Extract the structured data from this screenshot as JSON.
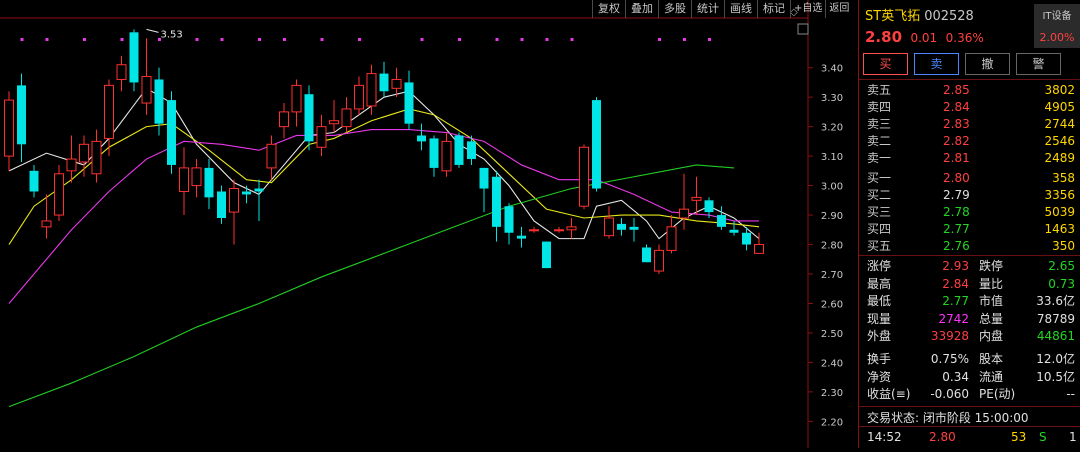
{
  "toolbar": {
    "items": [
      "复权",
      "叠加",
      "多股",
      "统计",
      "画线",
      "标记",
      "+自选",
      "返回"
    ]
  },
  "stock": {
    "name": "ST英飞拓",
    "code": "002528",
    "price": "2.80",
    "change": "0.01",
    "change_pct": "0.36%",
    "it_label": "IT设备",
    "it_pct": "2.00%"
  },
  "buttons": [
    "买",
    "卖",
    "撤",
    "警"
  ],
  "order_book": {
    "sell": [
      {
        "label": "卖五",
        "price": "2.85",
        "vol": "3802"
      },
      {
        "label": "卖四",
        "price": "2.84",
        "vol": "4905"
      },
      {
        "label": "卖三",
        "price": "2.83",
        "vol": "2744"
      },
      {
        "label": "卖二",
        "price": "2.82",
        "vol": "2546"
      },
      {
        "label": "卖一",
        "price": "2.81",
        "vol": "2489"
      }
    ],
    "buy": [
      {
        "label": "买一",
        "price": "2.80",
        "vol": "358"
      },
      {
        "label": "买二",
        "price": "2.79",
        "vol": "3356"
      },
      {
        "label": "买三",
        "price": "2.78",
        "vol": "5039"
      },
      {
        "label": "买四",
        "price": "2.77",
        "vol": "1463"
      },
      {
        "label": "买五",
        "price": "2.76",
        "vol": "350"
      }
    ]
  },
  "stats": {
    "limit_up_label": "涨停",
    "limit_up": "2.93",
    "limit_down_label": "跌停",
    "limit_down": "2.65",
    "high_label": "最高",
    "high": "2.84",
    "vol_ratio_label": "量比",
    "vol_ratio": "0.73",
    "low_label": "最低",
    "low": "2.77",
    "mkt_cap_label": "市值",
    "mkt_cap": "33.6亿",
    "cur_vol_label": "现量",
    "cur_vol": "2742",
    "total_vol_label": "总量",
    "total_vol": "78789",
    "outer_label": "外盘",
    "outer": "33928",
    "inner_label": "内盘",
    "inner": "44861",
    "turnover_label": "换手",
    "turnover": "0.75%",
    "equity_label": "股本",
    "equity": "12.0亿",
    "nav_label": "净资",
    "nav": "0.34",
    "float_label": "流通",
    "float": "10.5亿",
    "eps_label": "收益(≡)",
    "eps": "-0.060",
    "pe_label": "PE(动)",
    "pe": "--"
  },
  "trade_state": "交易状态: 闭市阶段 15:00:00",
  "last_tick": {
    "time": "14:52",
    "price": "2.80",
    "vol": "53",
    "side": "S",
    "count": "1"
  },
  "chart_data": {
    "type": "candlestick",
    "ylim": [
      2.13,
      3.46
    ],
    "yticks": [
      2.2,
      2.3,
      2.4,
      2.5,
      2.6,
      2.7,
      2.8,
      2.9,
      3.0,
      3.1,
      3.2,
      3.3,
      3.4
    ],
    "annotations": [
      {
        "label": "3.53",
        "x": 11,
        "y": 3.53
      }
    ],
    "candles": [
      {
        "o": 3.1,
        "c": 3.29,
        "h": 3.32,
        "l": 3.05
      },
      {
        "o": 3.34,
        "c": 3.14,
        "h": 3.38,
        "l": 3.08
      },
      {
        "o": 3.05,
        "c": 2.98,
        "h": 3.07,
        "l": 2.96
      },
      {
        "o": 2.86,
        "c": 2.88,
        "h": 2.97,
        "l": 2.82
      },
      {
        "o": 2.9,
        "c": 3.04,
        "h": 3.07,
        "l": 2.88
      },
      {
        "o": 3.05,
        "c": 3.09,
        "h": 3.17,
        "l": 3.01
      },
      {
        "o": 3.08,
        "c": 3.14,
        "h": 3.17,
        "l": 3.03
      },
      {
        "o": 3.04,
        "c": 3.15,
        "h": 3.19,
        "l": 3.01
      },
      {
        "o": 3.16,
        "c": 3.34,
        "h": 3.36,
        "l": 3.1
      },
      {
        "o": 3.36,
        "c": 3.41,
        "h": 3.44,
        "l": 3.32
      },
      {
        "o": 3.52,
        "c": 3.35,
        "h": 3.53,
        "l": 3.32
      },
      {
        "o": 3.28,
        "c": 3.37,
        "h": 3.5,
        "l": 3.24
      },
      {
        "o": 3.36,
        "c": 3.21,
        "h": 3.4,
        "l": 3.17
      },
      {
        "o": 3.29,
        "c": 3.07,
        "h": 3.32,
        "l": 3.04
      },
      {
        "o": 2.98,
        "c": 3.06,
        "h": 3.13,
        "l": 2.9
      },
      {
        "o": 3.0,
        "c": 3.06,
        "h": 3.09,
        "l": 2.96
      },
      {
        "o": 3.06,
        "c": 2.96,
        "h": 3.09,
        "l": 2.92
      },
      {
        "o": 2.98,
        "c": 2.89,
        "h": 3.0,
        "l": 2.87
      },
      {
        "o": 2.91,
        "c": 2.99,
        "h": 3.02,
        "l": 2.8
      },
      {
        "o": 2.98,
        "c": 2.97,
        "h": 3.0,
        "l": 2.94
      },
      {
        "o": 2.99,
        "c": 2.98,
        "h": 3.02,
        "l": 2.88
      },
      {
        "o": 3.06,
        "c": 3.14,
        "h": 3.17,
        "l": 3.02
      },
      {
        "o": 3.2,
        "c": 3.25,
        "h": 3.28,
        "l": 3.16
      },
      {
        "o": 3.25,
        "c": 3.34,
        "h": 3.36,
        "l": 3.2
      },
      {
        "o": 3.31,
        "c": 3.15,
        "h": 3.34,
        "l": 3.12
      },
      {
        "o": 3.13,
        "c": 3.2,
        "h": 3.24,
        "l": 3.1
      },
      {
        "o": 3.21,
        "c": 3.22,
        "h": 3.29,
        "l": 3.18
      },
      {
        "o": 3.2,
        "c": 3.26,
        "h": 3.3,
        "l": 3.18
      },
      {
        "o": 3.26,
        "c": 3.34,
        "h": 3.37,
        "l": 3.24
      },
      {
        "o": 3.27,
        "c": 3.38,
        "h": 3.41,
        "l": 3.24
      },
      {
        "o": 3.38,
        "c": 3.32,
        "h": 3.42,
        "l": 3.3
      },
      {
        "o": 3.33,
        "c": 3.36,
        "h": 3.4,
        "l": 3.3
      },
      {
        "o": 3.35,
        "c": 3.21,
        "h": 3.39,
        "l": 3.19
      },
      {
        "o": 3.17,
        "c": 3.15,
        "h": 3.21,
        "l": 3.12
      },
      {
        "o": 3.16,
        "c": 3.06,
        "h": 3.17,
        "l": 3.03
      },
      {
        "o": 3.05,
        "c": 3.15,
        "h": 3.18,
        "l": 3.03
      },
      {
        "o": 3.17,
        "c": 3.07,
        "h": 3.18,
        "l": 3.06
      },
      {
        "o": 3.15,
        "c": 3.09,
        "h": 3.17,
        "l": 3.07
      },
      {
        "o": 3.06,
        "c": 2.99,
        "h": 3.06,
        "l": 2.91
      },
      {
        "o": 3.03,
        "c": 2.86,
        "h": 3.05,
        "l": 2.81
      },
      {
        "o": 2.93,
        "c": 2.84,
        "h": 2.94,
        "l": 2.8
      },
      {
        "o": 2.83,
        "c": 2.82,
        "h": 2.86,
        "l": 2.79
      },
      {
        "o": 2.85,
        "c": 2.85,
        "h": 2.86,
        "l": 2.84
      },
      {
        "o": 2.81,
        "c": 2.72,
        "h": 2.81,
        "l": 2.72
      },
      {
        "o": 2.85,
        "c": 2.85,
        "h": 2.86,
        "l": 2.84
      },
      {
        "o": 2.85,
        "c": 2.86,
        "h": 2.89,
        "l": 2.82
      },
      {
        "o": 2.93,
        "c": 3.13,
        "h": 3.14,
        "l": 2.92
      },
      {
        "o": 3.29,
        "c": 2.99,
        "h": 3.3,
        "l": 2.98
      },
      {
        "o": 2.83,
        "c": 2.89,
        "h": 2.93,
        "l": 2.82
      },
      {
        "o": 2.87,
        "c": 2.85,
        "h": 2.89,
        "l": 2.83
      },
      {
        "o": 2.86,
        "c": 2.85,
        "h": 2.89,
        "l": 2.81
      },
      {
        "o": 2.79,
        "c": 2.74,
        "h": 2.8,
        "l": 2.74
      },
      {
        "o": 2.71,
        "c": 2.78,
        "h": 2.8,
        "l": 2.7
      },
      {
        "o": 2.78,
        "c": 2.86,
        "h": 2.9,
        "l": 2.77
      },
      {
        "o": 2.89,
        "c": 2.92,
        "h": 3.04,
        "l": 2.85
      },
      {
        "o": 2.95,
        "c": 2.96,
        "h": 3.03,
        "l": 2.9
      },
      {
        "o": 2.95,
        "c": 2.91,
        "h": 2.96,
        "l": 2.89
      },
      {
        "o": 2.9,
        "c": 2.86,
        "h": 2.93,
        "l": 2.85
      },
      {
        "o": 2.85,
        "c": 2.84,
        "h": 2.88,
        "l": 2.83
      },
      {
        "o": 2.84,
        "c": 2.8,
        "h": 2.86,
        "l": 2.78
      },
      {
        "o": 2.77,
        "c": 2.8,
        "h": 2.84,
        "l": 2.77
      }
    ],
    "ma": [
      {
        "color": "#e8e8e8",
        "values": [
          [
            0,
            3.05
          ],
          [
            3,
            3.11
          ],
          [
            6,
            3.07
          ],
          [
            8,
            3.16
          ],
          [
            11,
            3.33
          ],
          [
            13,
            3.28
          ],
          [
            15,
            3.14
          ],
          [
            18,
            3.01
          ],
          [
            20,
            2.97
          ],
          [
            22,
            3.07
          ],
          [
            24,
            3.17
          ],
          [
            26,
            3.18
          ],
          [
            28,
            3.24
          ],
          [
            30,
            3.3
          ],
          [
            32,
            3.32
          ],
          [
            34,
            3.24
          ],
          [
            36,
            3.14
          ],
          [
            38,
            3.09
          ],
          [
            40,
            3.0
          ],
          [
            42,
            2.88
          ],
          [
            44,
            2.82
          ],
          [
            46,
            2.82
          ],
          [
            47,
            2.93
          ],
          [
            49,
            2.95
          ],
          [
            51,
            2.88
          ],
          [
            52,
            2.82
          ],
          [
            54,
            2.89
          ],
          [
            56,
            2.93
          ],
          [
            58,
            2.89
          ],
          [
            60,
            2.82
          ]
        ]
      },
      {
        "color": "#e8e81a",
        "values": [
          [
            0,
            2.8
          ],
          [
            2,
            2.93
          ],
          [
            5,
            3.02
          ],
          [
            8,
            3.13
          ],
          [
            11,
            3.2
          ],
          [
            13,
            3.21
          ],
          [
            16,
            3.12
          ],
          [
            19,
            3.02
          ],
          [
            21,
            3.01
          ],
          [
            24,
            3.14
          ],
          [
            26,
            3.16
          ],
          [
            29,
            3.22
          ],
          [
            32,
            3.26
          ],
          [
            34,
            3.24
          ],
          [
            37,
            3.16
          ],
          [
            40,
            3.04
          ],
          [
            43,
            2.92
          ],
          [
            46,
            2.89
          ],
          [
            49,
            2.9
          ],
          [
            52,
            2.9
          ],
          [
            55,
            2.88
          ],
          [
            58,
            2.87
          ],
          [
            60,
            2.86
          ]
        ]
      },
      {
        "color": "#e838e8",
        "values": [
          [
            0,
            2.6
          ],
          [
            2,
            2.7
          ],
          [
            5,
            2.85
          ],
          [
            8,
            2.98
          ],
          [
            11,
            3.09
          ],
          [
            14,
            3.15
          ],
          [
            17,
            3.14
          ],
          [
            20,
            3.12
          ],
          [
            23,
            3.17
          ],
          [
            26,
            3.17
          ],
          [
            29,
            3.19
          ],
          [
            32,
            3.19
          ],
          [
            35,
            3.18
          ],
          [
            38,
            3.15
          ],
          [
            41,
            3.07
          ],
          [
            44,
            3.02
          ],
          [
            47,
            3.02
          ],
          [
            50,
            2.97
          ],
          [
            53,
            2.91
          ],
          [
            56,
            2.9
          ],
          [
            58,
            2.88
          ],
          [
            60,
            2.88
          ]
        ]
      },
      {
        "color": "#22cc22",
        "values": [
          [
            0,
            2.25
          ],
          [
            5,
            2.33
          ],
          [
            10,
            2.42
          ],
          [
            15,
            2.52
          ],
          [
            20,
            2.6
          ],
          [
            25,
            2.69
          ],
          [
            30,
            2.77
          ],
          [
            35,
            2.85
          ],
          [
            40,
            2.93
          ],
          [
            45,
            2.99
          ],
          [
            50,
            3.03
          ],
          [
            55,
            3.07
          ],
          [
            58,
            3.06
          ]
        ]
      }
    ],
    "markers_y": 3.65,
    "markers_x": [
      1,
      3,
      6,
      9,
      12,
      15,
      17,
      20,
      22,
      25,
      28,
      33,
      36,
      39,
      41,
      43,
      45,
      52,
      54,
      56
    ]
  }
}
